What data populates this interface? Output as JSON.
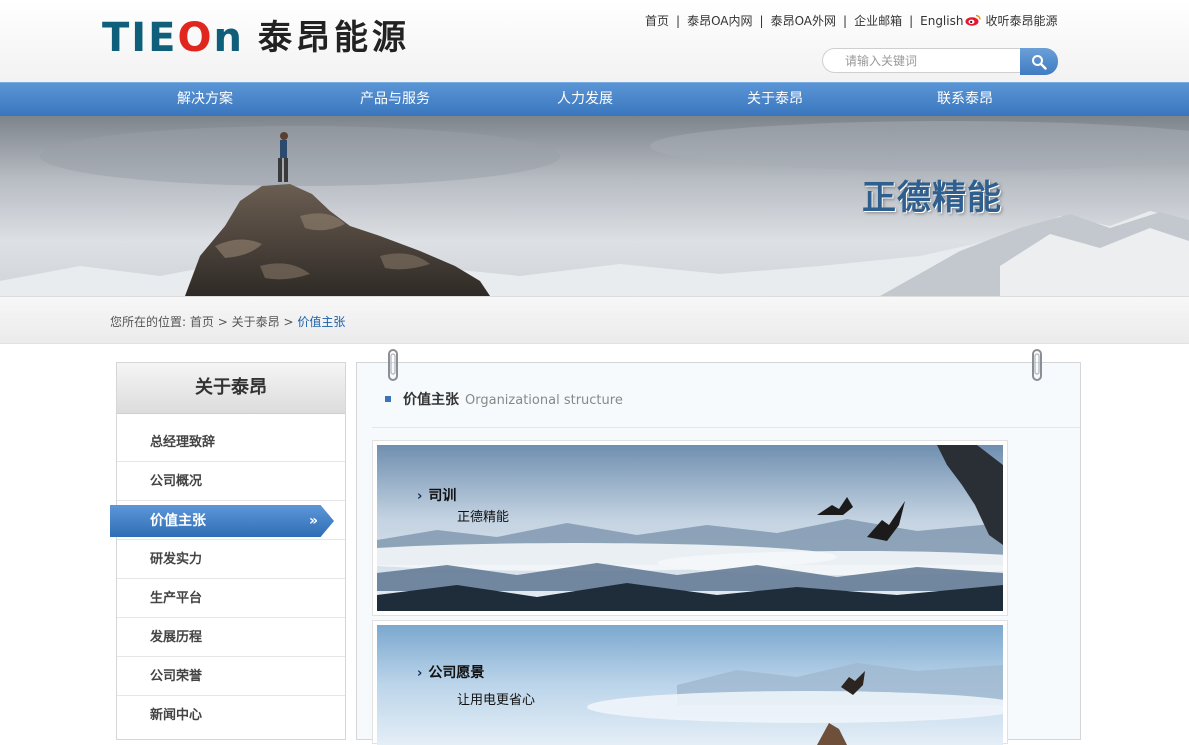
{
  "header": {
    "logo_mark_pre": "TIE",
    "logo_mark_o": "O",
    "logo_mark_post": "n",
    "logo_cn": "泰昂能源",
    "links": [
      "首页",
      "泰昂OA内网",
      "泰昂OA外网",
      "企业邮箱",
      "English"
    ],
    "follow": "收听泰昂能源",
    "separator": "|",
    "search_placeholder": "请输入关键词"
  },
  "nav": {
    "items": [
      "解决方案",
      "产品与服务",
      "人力发展",
      "关于泰昂",
      "联系泰昂"
    ]
  },
  "banner": {
    "slogan": "正德精能"
  },
  "breadcrumb": {
    "prefix": "您所在的位置:",
    "home": "首页",
    "sep": ">",
    "parent": "关于泰昂",
    "current": "价值主张"
  },
  "sidebar": {
    "title": "关于泰昂",
    "items": [
      "总经理致辞",
      "公司概况",
      "价值主张",
      "研发实力",
      "生产平台",
      "发展历程",
      "公司荣誉",
      "新闻中心"
    ],
    "active_index": 2,
    "active_arrow": "»"
  },
  "content": {
    "title": "价值主张",
    "subtitle": "Organizational structure",
    "panels": [
      {
        "heading": "司训",
        "text": "正德精能"
      },
      {
        "heading": "公司愿景",
        "text": "让用电更省心"
      }
    ],
    "chevron": "›"
  },
  "colors": {
    "nav_blue": "#3a76bd",
    "logo_teal": "#0f5e7a",
    "logo_red": "#e0261d",
    "link_blue": "#1b5fa8"
  }
}
